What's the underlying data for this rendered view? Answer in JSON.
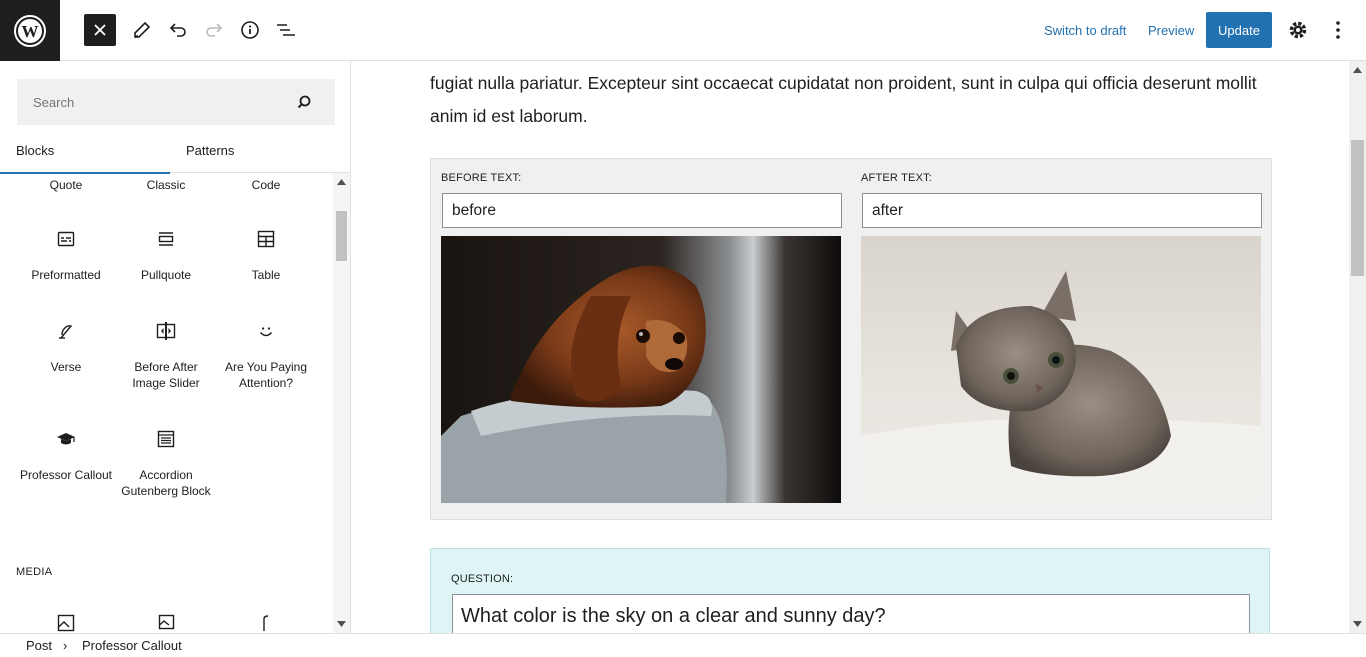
{
  "header": {
    "switch_to_draft": "Switch to draft",
    "preview": "Preview",
    "update": "Update"
  },
  "sidebar": {
    "search_placeholder": "Search",
    "tabs": [
      "Blocks",
      "Patterns"
    ],
    "blocks": [
      {
        "label": "Quote",
        "icon": "quote-icon"
      },
      {
        "label": "Classic",
        "icon": "classic-icon"
      },
      {
        "label": "Code",
        "icon": "code-icon"
      },
      {
        "label": "Preformatted",
        "icon": "preformatted-icon"
      },
      {
        "label": "Pullquote",
        "icon": "pullquote-icon"
      },
      {
        "label": "Table",
        "icon": "table-icon"
      },
      {
        "label": "Verse",
        "icon": "verse-icon"
      },
      {
        "label": "Before After Image Slider",
        "icon": "image-slider-icon"
      },
      {
        "label": "Are You Paying Attention?",
        "icon": "smiley-icon"
      },
      {
        "label": "Professor Callout",
        "icon": "graduation-cap-icon"
      },
      {
        "label": "Accordion Gutenberg Block",
        "icon": "accordion-icon"
      }
    ],
    "category_media": "MEDIA"
  },
  "editor": {
    "paragraph": "fugiat nulla pariatur. Excepteur sint occaecat cupidatat non proident, sunt in culpa qui officia deserunt mollit anim id est laborum.",
    "before_label": "BEFORE TEXT:",
    "before_value": "before",
    "after_label": "AFTER TEXT:",
    "after_value": "after",
    "question_label": "QUESTION:",
    "question_value": "What color is the sky on a clear and sunny day?"
  },
  "footer": {
    "crumb_post": "Post",
    "crumb_sep": "›",
    "crumb_block": "Professor Callout"
  },
  "colors": {
    "accent": "#2271b1",
    "dark": "#1e1e1e",
    "callout_bg": "#dff4f5"
  }
}
